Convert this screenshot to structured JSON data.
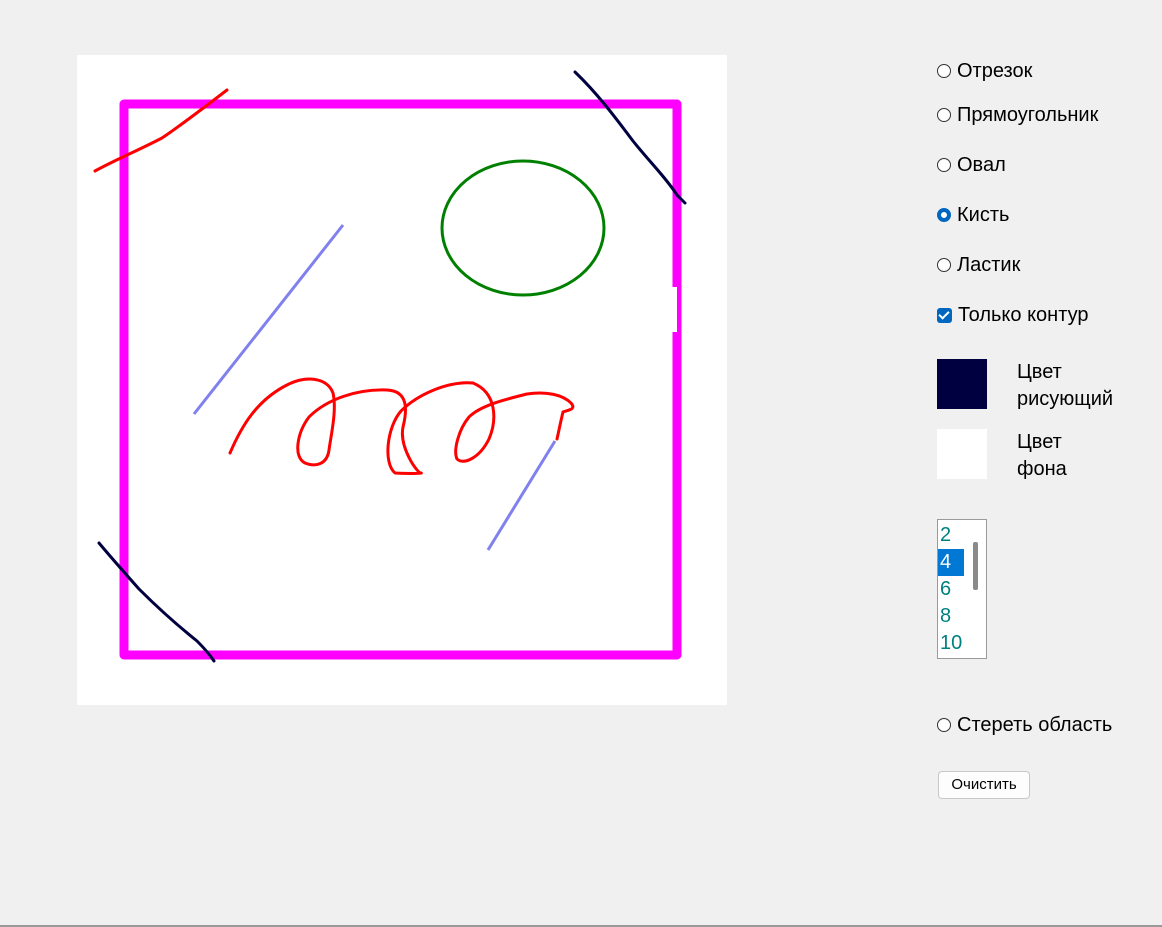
{
  "tools": [
    {
      "label": "Отрезок",
      "checked": false
    },
    {
      "label": "Прямоугольник",
      "checked": false
    },
    {
      "label": "Овал",
      "checked": false
    },
    {
      "label": "Кисть",
      "checked": true
    },
    {
      "label": "Ластик",
      "checked": false
    }
  ],
  "outline_only": {
    "label": "Только контур",
    "checked": true
  },
  "colors": {
    "draw": {
      "label_line1": "Цвет",
      "label_line2": "рисующий",
      "value": "#000040"
    },
    "background": {
      "label_line1": "Цвет",
      "label_line2": "фона",
      "value": "#ffffff"
    }
  },
  "brush_sizes": {
    "items": [
      "2",
      "4",
      "6",
      "8",
      "10"
    ],
    "selected": "4"
  },
  "erase_area": {
    "label": "Стереть область",
    "checked": false
  },
  "clear_button": {
    "label": "Очистить"
  },
  "canvas_colors": {
    "rectangle": "#ff00ff",
    "oval": "#008000",
    "red_strokes": "#ff0000",
    "blue_lines": "#8080ee",
    "dark_strokes": "#000040"
  }
}
